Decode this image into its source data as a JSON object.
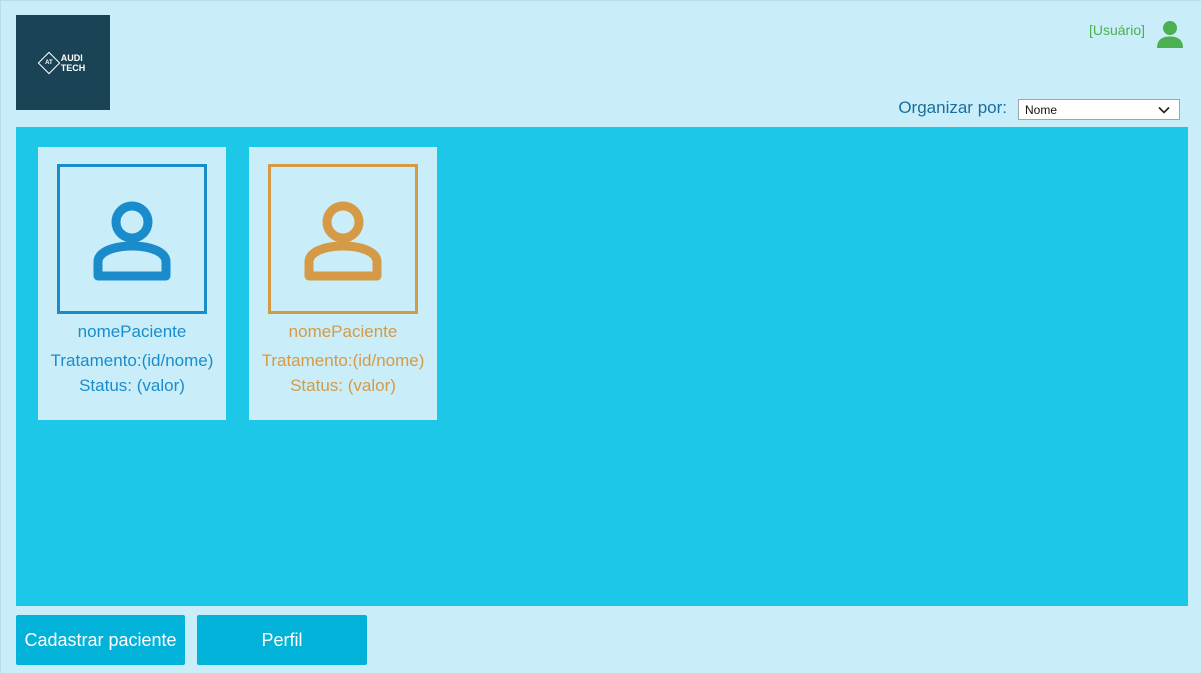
{
  "header": {
    "logo": {
      "mark": "AT",
      "line1": "AUDI",
      "line2": "TECH"
    },
    "user_label": "[Usuário]",
    "user_icon": "user-icon"
  },
  "sort": {
    "label": "Organizar por:",
    "selected": "Nome"
  },
  "patients": [
    {
      "name": "nomePaciente",
      "treatment": "Tratamento:(id/nome)",
      "status": "Status: (valor)",
      "color": "#1a8ccc"
    },
    {
      "name": "nomePaciente",
      "treatment": "Tratamento:(id/nome)",
      "status": "Status: (valor)",
      "color": "#d49a46"
    }
  ],
  "buttons": {
    "register": "Cadastrar paciente",
    "profile": "Perfil"
  },
  "colors": {
    "background": "#caeef9",
    "panel": "#1dc7e8",
    "button": "#03b2d8",
    "user_accent": "#4caf50",
    "logo_bg": "#1b4356"
  }
}
